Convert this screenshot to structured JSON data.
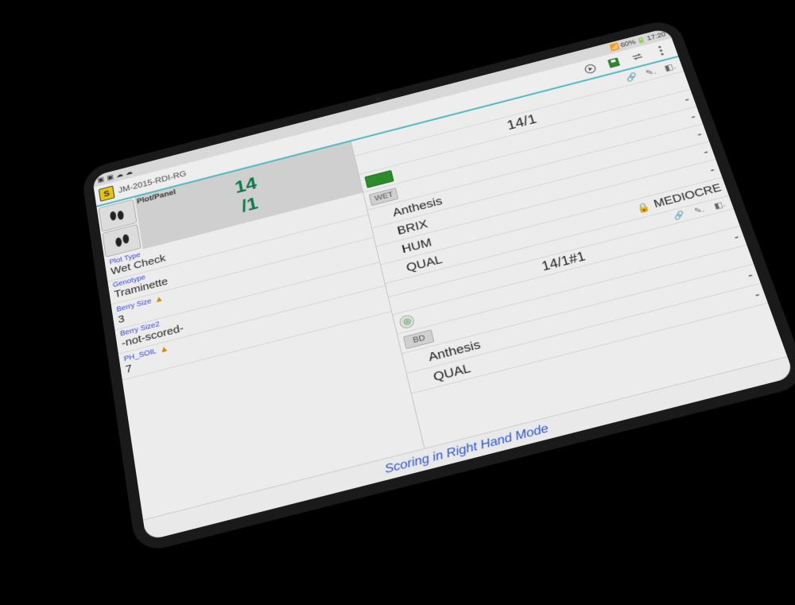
{
  "status": {
    "network": "60%",
    "time": "17:20"
  },
  "actionbar": {
    "title": "JM-2015-RDI-RG"
  },
  "left": {
    "plot_label": "Plot/Panel",
    "plot_line1": "14",
    "plot_line2": "/1",
    "attrs": [
      {
        "label": "Plot Type",
        "value": "Wet Check",
        "warn": false
      },
      {
        "label": "Genotype",
        "value": "Traminette",
        "warn": false
      },
      {
        "label": "Berry Size",
        "value": "3",
        "warn": true
      },
      {
        "label": "Berry Size2",
        "value": "-not-scored-",
        "warn": false
      },
      {
        "label": "PH_SOIL",
        "value": "7",
        "warn": true
      }
    ]
  },
  "right": {
    "header": "14/1",
    "groups": [
      {
        "row_tools": true,
        "tag_rows": [
          {
            "badge": "green-square"
          },
          {
            "badge": "WET"
          }
        ],
        "traits": [
          {
            "name": "Anthesis",
            "value": "-",
            "lock": false
          },
          {
            "name": "BRIX",
            "value": "-",
            "lock": false
          },
          {
            "name": "HUM",
            "value": "-",
            "lock": false
          },
          {
            "name": "QUAL",
            "value": "MEDIOCRE",
            "lock": true
          }
        ]
      },
      {
        "row_tools": true,
        "header": "14/1#1",
        "tag_rows": [
          {
            "badge": "round"
          },
          {
            "badge": "BD"
          }
        ],
        "traits": [
          {
            "name": "Anthesis",
            "value": "-",
            "lock": false
          },
          {
            "name": "QUAL",
            "value": "-",
            "lock": false
          }
        ]
      }
    ]
  },
  "footer": "Scoring in Right Hand Mode"
}
